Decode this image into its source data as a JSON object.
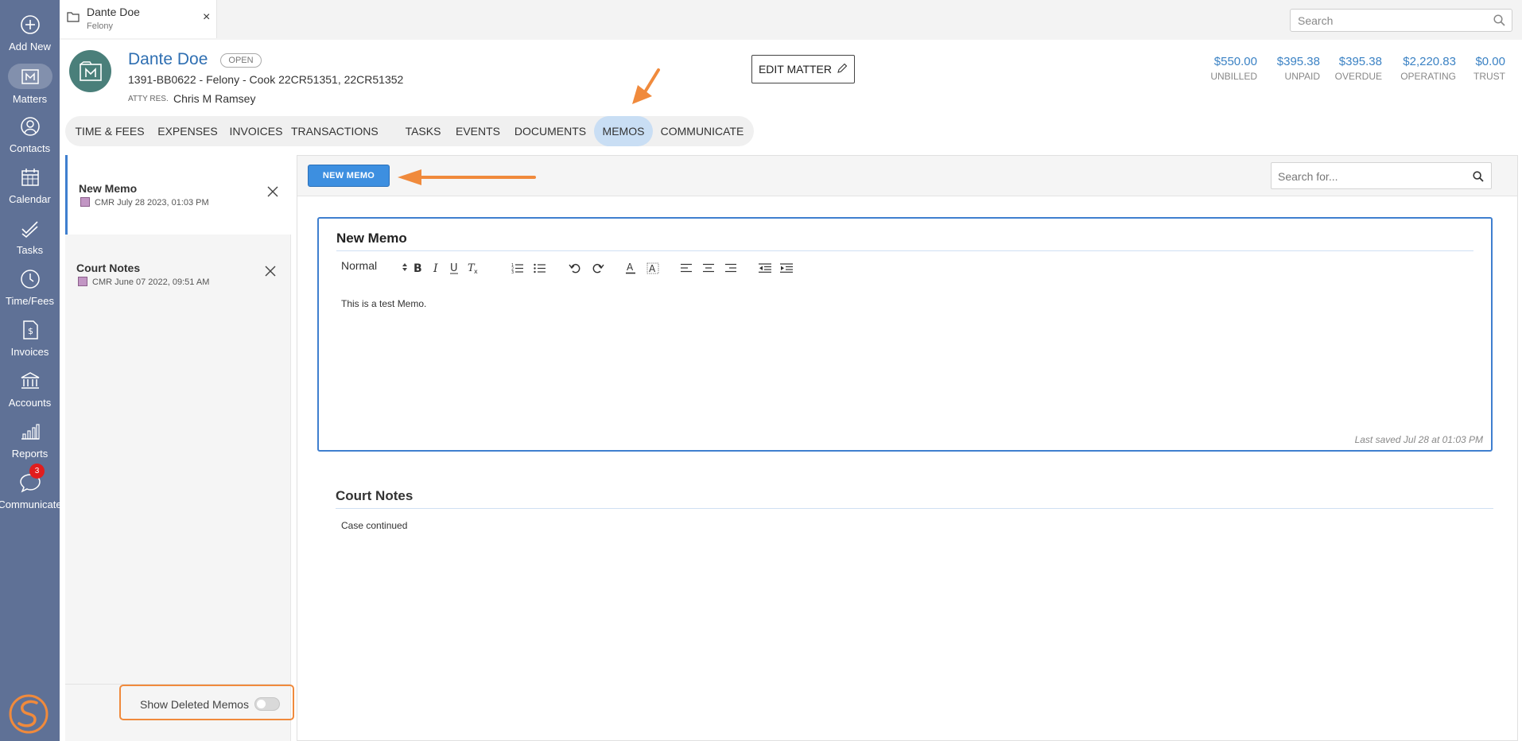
{
  "nav": {
    "items": [
      {
        "label": "Add New",
        "icon": "plus-circle-icon"
      },
      {
        "label": "Matters",
        "icon": "matters-icon",
        "active": true
      },
      {
        "label": "Contacts",
        "icon": "contacts-icon"
      },
      {
        "label": "Calendar",
        "icon": "calendar-icon"
      },
      {
        "label": "Tasks",
        "icon": "tasks-icon"
      },
      {
        "label": "Time/Fees",
        "icon": "clock-icon"
      },
      {
        "label": "Invoices",
        "icon": "invoice-icon"
      },
      {
        "label": "Accounts",
        "icon": "bank-icon"
      },
      {
        "label": "Reports",
        "icon": "bar-chart-icon"
      },
      {
        "label": "Communicate",
        "icon": "chat-icon",
        "badge": "3"
      }
    ]
  },
  "matter_tab": {
    "name": "Dante Doe",
    "sub": "Felony",
    "close": "×"
  },
  "global_search": {
    "placeholder": "Search"
  },
  "matter": {
    "client": "Dante Doe",
    "status": "OPEN",
    "line": "1391-BB0622 - Felony - Cook 22CR51351, 22CR51352",
    "atty_label": "ATTY RES.",
    "atty_name": "Chris M Ramsey",
    "edit_label": "EDIT MATTER"
  },
  "financials": [
    {
      "amount": "$550.00",
      "label": "UNBILLED"
    },
    {
      "amount": "$395.38",
      "label": "UNPAID"
    },
    {
      "amount": "$395.38",
      "label": "OVERDUE"
    },
    {
      "amount": "$2,220.83",
      "label": "OPERATING"
    },
    {
      "amount": "$0.00",
      "label": "TRUST"
    }
  ],
  "section_tabs": [
    "TIME & FEES",
    "EXPENSES",
    "INVOICES",
    "TRANSACTIONS",
    "TASKS",
    "EVENTS",
    "DOCUMENTS",
    "MEMOS",
    "COMMUNICATE"
  ],
  "active_tab": "MEMOS",
  "memos": [
    {
      "title": "New Memo",
      "meta": "CMR July 28 2023, 01:03 PM"
    },
    {
      "title": "Court Notes",
      "meta": "CMR June 07 2022, 09:51 AM"
    }
  ],
  "show_deleted": {
    "label": "Show Deleted Memos",
    "on": false
  },
  "toolbar": {
    "new_memo": "NEW MEMO",
    "search_placeholder": "Search for..."
  },
  "editor": {
    "title": "New Memo",
    "format": "Normal",
    "body": "This is a test Memo.",
    "saved": "Last saved Jul 28 at 01:03 PM"
  },
  "second_note": {
    "title": "Court Notes",
    "body": "Case continued"
  },
  "colors": {
    "nav_bg": "#5f7196",
    "accent": "#3d8fe0",
    "link": "#2f6fb2",
    "highlight": "#f08a3c"
  }
}
